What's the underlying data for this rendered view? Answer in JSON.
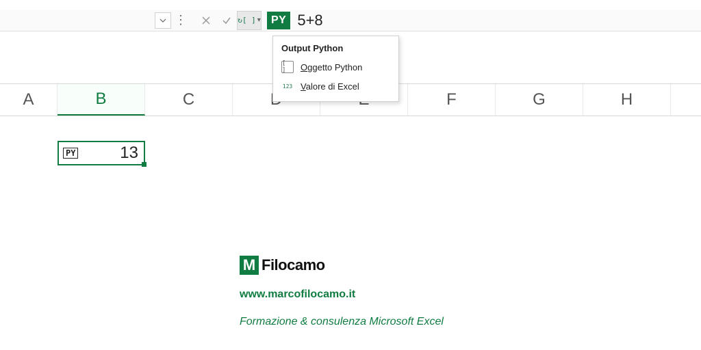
{
  "formula_bar": {
    "py_badge": "PY",
    "formula": "5+8"
  },
  "dropdown": {
    "title": "Output Python",
    "items": [
      {
        "icon": "[ ]",
        "label_pre": "O",
        "label_rest": "ggetto Python"
      },
      {
        "icon": "123",
        "label_pre": "V",
        "label_rest": "alore di Excel"
      }
    ]
  },
  "columns": [
    "A",
    "B",
    "C",
    "D",
    "E",
    "F",
    "G",
    "H"
  ],
  "selected_column_index": 1,
  "cell": {
    "tag": "PY",
    "value": "13"
  },
  "brand": {
    "logo_letter": "M",
    "name": "Filocamo",
    "url": "www.marcofilocamo.it",
    "tagline": "Formazione & consulenza Microsoft Excel"
  }
}
